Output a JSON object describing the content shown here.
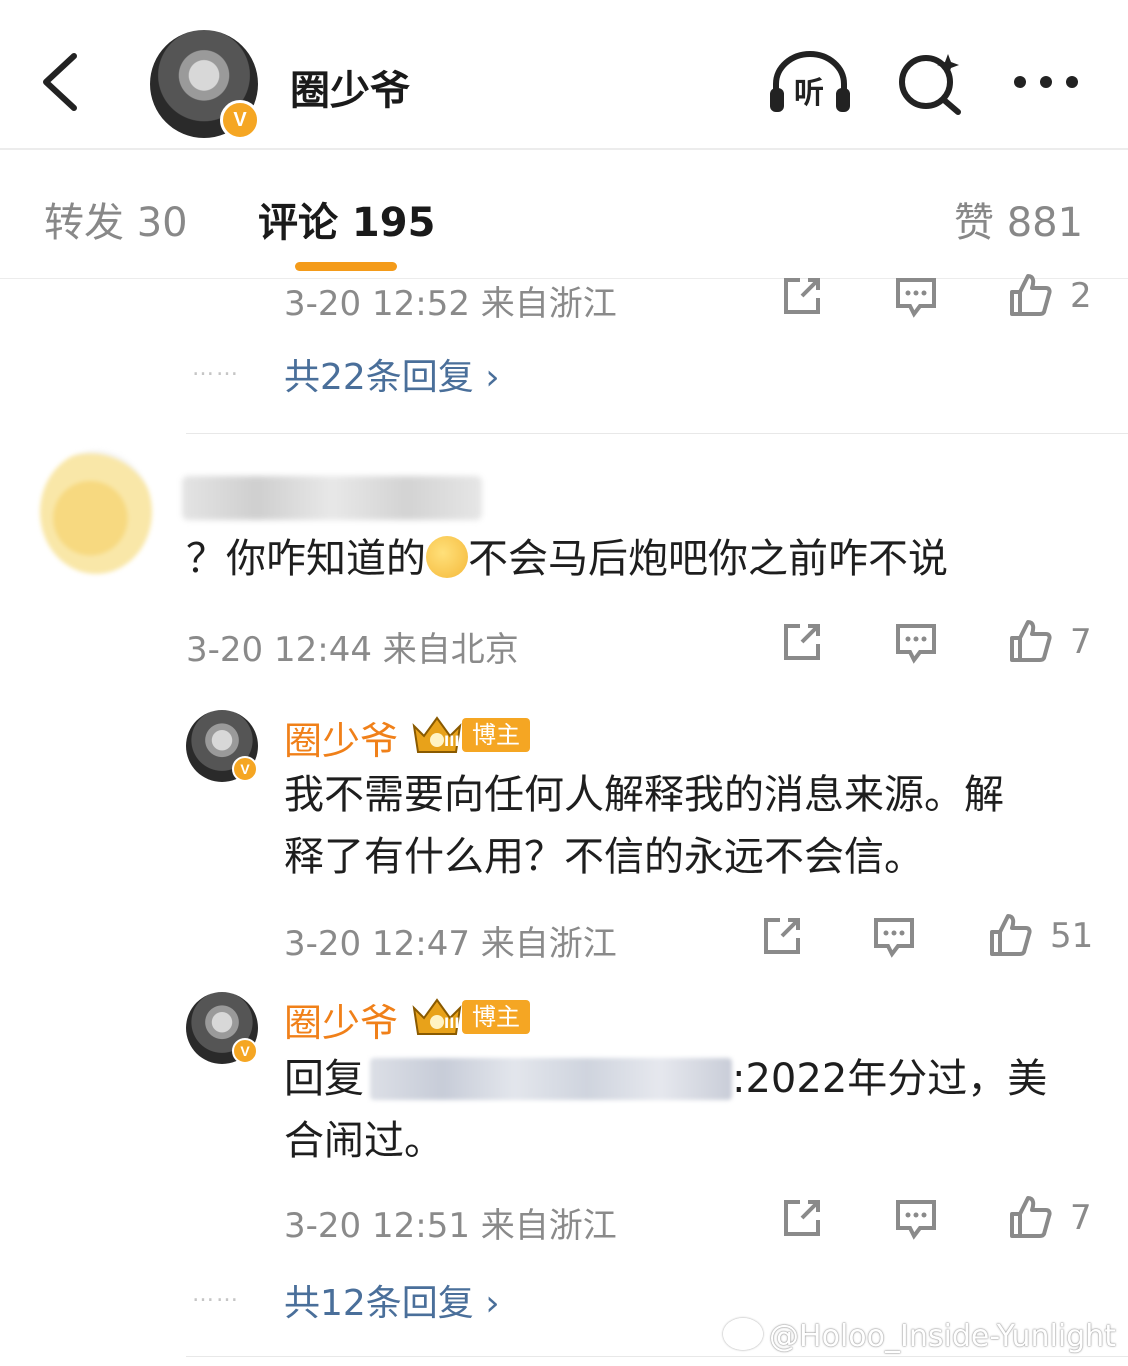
{
  "header": {
    "title": "圈少爷",
    "listen_label": "听",
    "verified_mark": "V"
  },
  "tabs": [
    {
      "label": "转发 30"
    },
    {
      "label": "评论 195"
    },
    {
      "label": "赞 881"
    }
  ],
  "comments": [
    {
      "meta": "3-20 12:52 来自浙江",
      "likes": "2",
      "replies_link": "共22条回复 ›",
      "dots": "……"
    },
    {
      "text_before": "？你咋知道的",
      "text_after": "不会马后炮吧你之前咋不说",
      "meta": "3-20 12:44 来自北京",
      "likes": "7",
      "replies": [
        {
          "author": "圈少爷",
          "badge": "博主",
          "crown_level": "III",
          "line1": "我不需要向任何人解释我的消息来源。解",
          "line2": "释了有什么用？不信的永远不会信。",
          "meta": "3-20 12:47 来自浙江",
          "likes": "51"
        },
        {
          "author": "圈少爷",
          "badge": "博主",
          "crown_level": "III",
          "line1_prefix": "回复",
          "line1_suffix": ":2022年分过，美",
          "line2": "合闹过。",
          "meta": "3-20 12:51 来自浙江",
          "likes": "7"
        }
      ],
      "replies_link": "共12条回复 ›",
      "dots": "……"
    }
  ],
  "watermark": "@Holoo_Inside-Yunlight",
  "colors": {
    "accent": "#f49b1a",
    "name": "#f08019",
    "link": "#4a6f9a",
    "meta": "#8a8a8a"
  }
}
